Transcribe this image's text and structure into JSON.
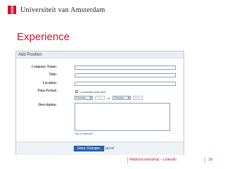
{
  "header": {
    "university_name": "Universiteit van Amsterdam"
  },
  "slide": {
    "title": "Experience"
  },
  "form": {
    "panel_title": "Add Position",
    "labels": {
      "company_name": "Company Name:",
      "title": "Title:",
      "location": "Location:",
      "time_period": "Time Period:",
      "description": "Description:"
    },
    "values": {
      "company_name": "",
      "title": "",
      "location": "",
      "description": ""
    },
    "currently_work_here_label": "I currently work here",
    "currently_work_here_checked": false,
    "start_month": "Choose...",
    "start_year_placeholder": "Year",
    "to_label": "to",
    "end_month": "Choose...",
    "end_year_placeholder": "Year",
    "tips_link": "Tips & examples",
    "save_button": "Save Changes",
    "or_text": "or",
    "cancel_link": "Cancel"
  },
  "footer": {
    "text": "Weblood workshop – LinkedIn",
    "page_number": "18"
  },
  "colors": {
    "brand_red": "#c8102e",
    "button_blue": "#2a67b0",
    "panel_header": "#e9eef4"
  }
}
